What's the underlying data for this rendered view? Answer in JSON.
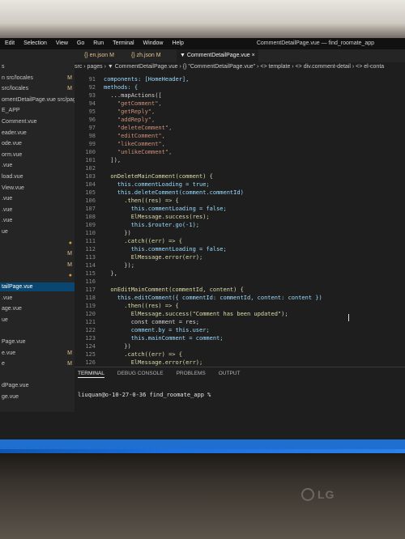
{
  "menubar": {
    "items": [
      "Edit",
      "Selection",
      "View",
      "Go",
      "Run",
      "Terminal",
      "Window",
      "Help"
    ],
    "window_title": "CommentDetailPage.vue — find_roomate_app"
  },
  "sidebar": {
    "rows": [
      {
        "text": "s",
        "badge": ""
      },
      {
        "text": "n src/locales",
        "badge": "M"
      },
      {
        "text": "src/locales",
        "badge": "M"
      },
      {
        "text": "omentDetailPage.vue  src/pages",
        "badge": ""
      },
      {
        "text": "E_APP",
        "badge": ""
      },
      {
        "text": "Comment.vue",
        "badge": ""
      },
      {
        "text": "eader.vue",
        "badge": ""
      },
      {
        "text": "ode.vue",
        "badge": ""
      },
      {
        "text": "orm.vue",
        "badge": ""
      },
      {
        "text": ".vue",
        "badge": ""
      },
      {
        "text": "load.vue",
        "badge": ""
      },
      {
        "text": "View.vue",
        "badge": ""
      },
      {
        "text": ".vue",
        "badge": ""
      },
      {
        "text": ".vue",
        "badge": ""
      },
      {
        "text": ".vue",
        "badge": ""
      },
      {
        "text": "ue",
        "badge": ""
      },
      {
        "text": "",
        "badge": "●"
      },
      {
        "text": "",
        "badge": "M"
      },
      {
        "text": "",
        "badge": "M"
      },
      {
        "text": "",
        "badge": "●"
      },
      {
        "text": "tailPage.vue",
        "badge": ""
      },
      {
        "text": ".vue",
        "badge": ""
      },
      {
        "text": "age.vue",
        "badge": ""
      },
      {
        "text": "ue",
        "badge": ""
      },
      {
        "text": "",
        "badge": ""
      },
      {
        "text": "Page.vue",
        "badge": ""
      },
      {
        "text": "e.vue",
        "badge": "M"
      },
      {
        "text": "e",
        "badge": "M"
      },
      {
        "text": "",
        "badge": ""
      },
      {
        "text": "dPage.vue",
        "badge": ""
      },
      {
        "text": "ge.vue",
        "badge": ""
      }
    ],
    "active_row": 20
  },
  "tabs": [
    {
      "label": "{} en.json M"
    },
    {
      "label": "{} zh.json M"
    },
    {
      "label": "▼ CommentDetailPage.vue  ×"
    }
  ],
  "breadcrumb": "src › pages › ▼ CommentDetailPage.vue › {} \"CommentDetailPage.vue\" › <> template › <> div.comment-detail › <> el-conta",
  "editor": {
    "lines": [
      {
        "n": "91",
        "code": "components: [HomeHeader],"
      },
      {
        "n": "92",
        "code": "methods: {"
      },
      {
        "n": "93",
        "code": "  ...mapActions(["
      },
      {
        "n": "94",
        "code": "    \"getComment\","
      },
      {
        "n": "95",
        "code": "    \"getReply\","
      },
      {
        "n": "96",
        "code": "    \"addReply\","
      },
      {
        "n": "97",
        "code": "    \"deleteComment\","
      },
      {
        "n": "98",
        "code": "    \"editComment\","
      },
      {
        "n": "99",
        "code": "    \"likeComment\","
      },
      {
        "n": "100",
        "code": "    \"unlikeComment\","
      },
      {
        "n": "101",
        "code": "  ]),"
      },
      {
        "n": "102",
        "code": ""
      },
      {
        "n": "103",
        "code": "  onDeleteMainComment(comment) {"
      },
      {
        "n": "104",
        "code": "    this.commentLoading = true;"
      },
      {
        "n": "105",
        "code": "    this.deleteComment(comment.commentId)"
      },
      {
        "n": "106",
        "code": "      .then((res) => {"
      },
      {
        "n": "107",
        "code": "        this.commentLoading = false;"
      },
      {
        "n": "108",
        "code": "        ElMessage.success(res);"
      },
      {
        "n": "109",
        "code": "        this.$router.go(-1);"
      },
      {
        "n": "110",
        "code": "      })"
      },
      {
        "n": "111",
        "code": "      .catch((err) => {"
      },
      {
        "n": "112",
        "code": "        this.commentLoading = false;"
      },
      {
        "n": "113",
        "code": "        ElMessage.error(err);"
      },
      {
        "n": "114",
        "code": "      });"
      },
      {
        "n": "115",
        "code": "  },"
      },
      {
        "n": "116",
        "code": ""
      },
      {
        "n": "117",
        "code": "  onEditMainComment(commentId, content) {"
      },
      {
        "n": "118",
        "code": "    this.editComment({ commentId: commentId, content: content })"
      },
      {
        "n": "119",
        "code": "      .then((res) => {"
      },
      {
        "n": "120",
        "code": "        ElMessage.success(\"Comment has been updated\");"
      },
      {
        "n": "121",
        "code": "        const comment = res;"
      },
      {
        "n": "122",
        "code": "        comment.by = this.user;"
      },
      {
        "n": "123",
        "code": "        this.mainComment = comment;"
      },
      {
        "n": "124",
        "code": "      })"
      },
      {
        "n": "125",
        "code": "      .catch((err) => {"
      },
      {
        "n": "126",
        "code": "        ElMessage.error(err);"
      }
    ]
  },
  "panel": {
    "tabs": [
      "TERMINAL",
      "DEBUG CONSOLE",
      "PROBLEMS",
      "OUTPUT"
    ],
    "active_tab": "TERMINAL",
    "terminal_prompt": "liuquan@o-10-27-0-36 find_roomate_app %"
  },
  "dock": {
    "icons": [
      "finder-icon",
      "launchpad-icon",
      "chrome-icon",
      "vscode-icon",
      "jetbrains-icon",
      "terminal-icon",
      "trello-icon",
      "pencil-icon",
      "messages-icon",
      "wechat-icon",
      "spotify-icon",
      "safari-icon",
      "activity-icon"
    ]
  },
  "monitor_brand": "LG",
  "colors": {
    "editor_bg": "#1e1e1e",
    "keyword": "#569cd6",
    "string": "#ce9178",
    "function": "#dcdcaa",
    "identifier": "#9cdcfe",
    "status_bar": "#1f6fd1"
  }
}
